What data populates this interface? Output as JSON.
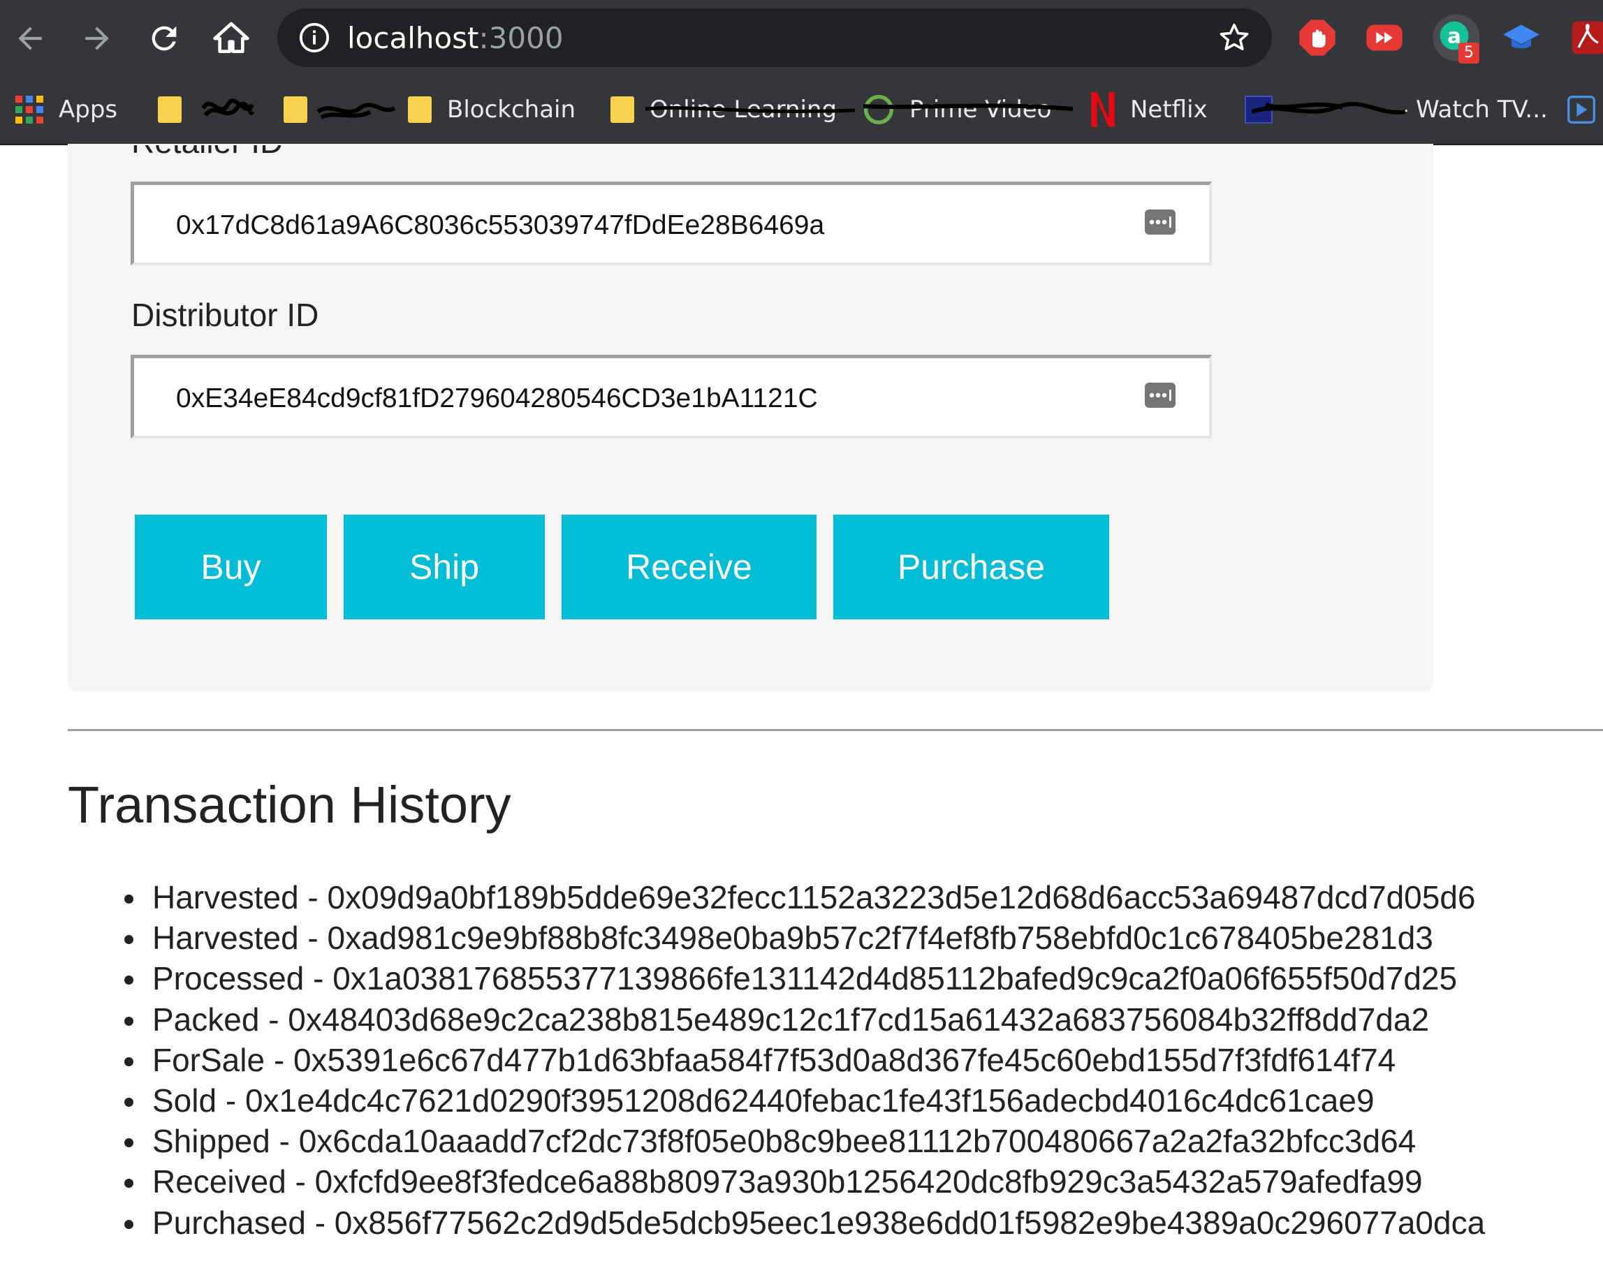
{
  "browser": {
    "url_host": "localhost",
    "url_port": ":3000",
    "extension_badge": "5",
    "bookmarks": {
      "apps": "Apps",
      "folder_1": "",
      "folder_2": "",
      "blockchain": "Blockchain",
      "online_learning": "Online Learning",
      "prime_video": "Prime Video",
      "netflix": "Netflix",
      "watch_tv": "- Watch TV..."
    }
  },
  "form": {
    "retailer_label": "Retailer ID",
    "retailer_value": "0x17dC8d61a9A6C8036c553039747fDdEe28B6469a",
    "distributor_label": "Distributor ID",
    "distributor_value": "0xE34eE84cd9cf81fD279604280546CD3e1bA1121C"
  },
  "actions": {
    "buy": "Buy",
    "ship": "Ship",
    "receive": "Receive",
    "purchase": "Purchase"
  },
  "history": {
    "title": "Transaction History",
    "items": [
      "Harvested - 0x09d9a0bf189b5dde69e32fecc1152a3223d5e12d68d6acc53a69487dcd7d05d6",
      "Harvested - 0xad981c9e9bf88b8fc3498e0ba9b57c2f7f4ef8fb758ebfd0c1c678405be281d3",
      "Processed - 0x1a038176855377139866fe131142d4d85112bafed9c9ca2f0a06f655f50d7d25",
      "Packed - 0x48403d68e9c2ca238b815e489c12c1f7cd15a61432a683756084b32ff8dd7da2",
      "ForSale - 0x5391e6c67d477b1d63bfaa584f7f53d0a8d367fe45c60ebd155d7f3fdf614f74",
      "Sold - 0x1e4dc4c7621d0290f3951208d62440febac1fe43f156adecbd4016c4dc61cae9",
      "Shipped - 0x6cda10aaadd7cf2dc73f8f05e0b8c9bee81112b700480667a2a2fa32bfcc3d64",
      "Received - 0xfcfd9ee8f3fedce6a88b80973a930b1256420dc8fb929c3a5432a579afedfa99",
      "Purchased - 0x856f77562c2d9d5de5dcb95eec1e938e6dd01f5982e9be4389a0c296077a0dca"
    ]
  },
  "colors": {
    "chrome_dark": "#35363a",
    "button": "#00bcd4",
    "card": "#f5f5f5"
  }
}
